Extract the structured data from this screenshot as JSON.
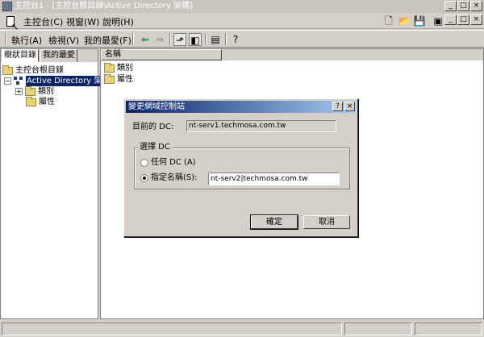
{
  "window": {
    "title": "主控台1 - [主控台根目錄\\Active Directory 架構]",
    "buttons": [
      "_",
      "□",
      "×"
    ]
  },
  "menubar": {
    "console": "主控台(C)",
    "window": "視窗(W)",
    "help": "說明(H)"
  },
  "mdi_buttons": [
    "_",
    "□",
    "×"
  ],
  "toolbar": {
    "action": "執行(A)",
    "view": "檢視(V)",
    "favorites": "我的最愛(F)"
  },
  "left_pane": {
    "tabs": [
      "樹狀目錄",
      "我的最愛"
    ],
    "tree": {
      "root": "主控台根目錄",
      "node": "Active Directory 架構",
      "children": [
        "類別",
        "屬性"
      ]
    }
  },
  "right_pane": {
    "column_header": "名稱",
    "items": [
      "類別",
      "屬性"
    ]
  },
  "dialog": {
    "title": "變更網域控制站",
    "help_btn": "?",
    "close_btn": "×",
    "current_dc_label": "目前的 DC:",
    "current_dc_value": "nt-serv1.techmosa.com.tw",
    "group_label": "選擇 DC",
    "option_any": "任何 DC (A)",
    "option_specify": "指定名稱(S):",
    "selected_option": "option_specify",
    "specify_value": "nt-serv2|techmosa.com.tw",
    "ok_label": "確定",
    "cancel_label": "取消"
  },
  "colors": {
    "dialog_title_start": "#0a246a",
    "dialog_title_end": "#a6caf0",
    "face": "#d4d0c8",
    "selection": "#0a246a"
  }
}
